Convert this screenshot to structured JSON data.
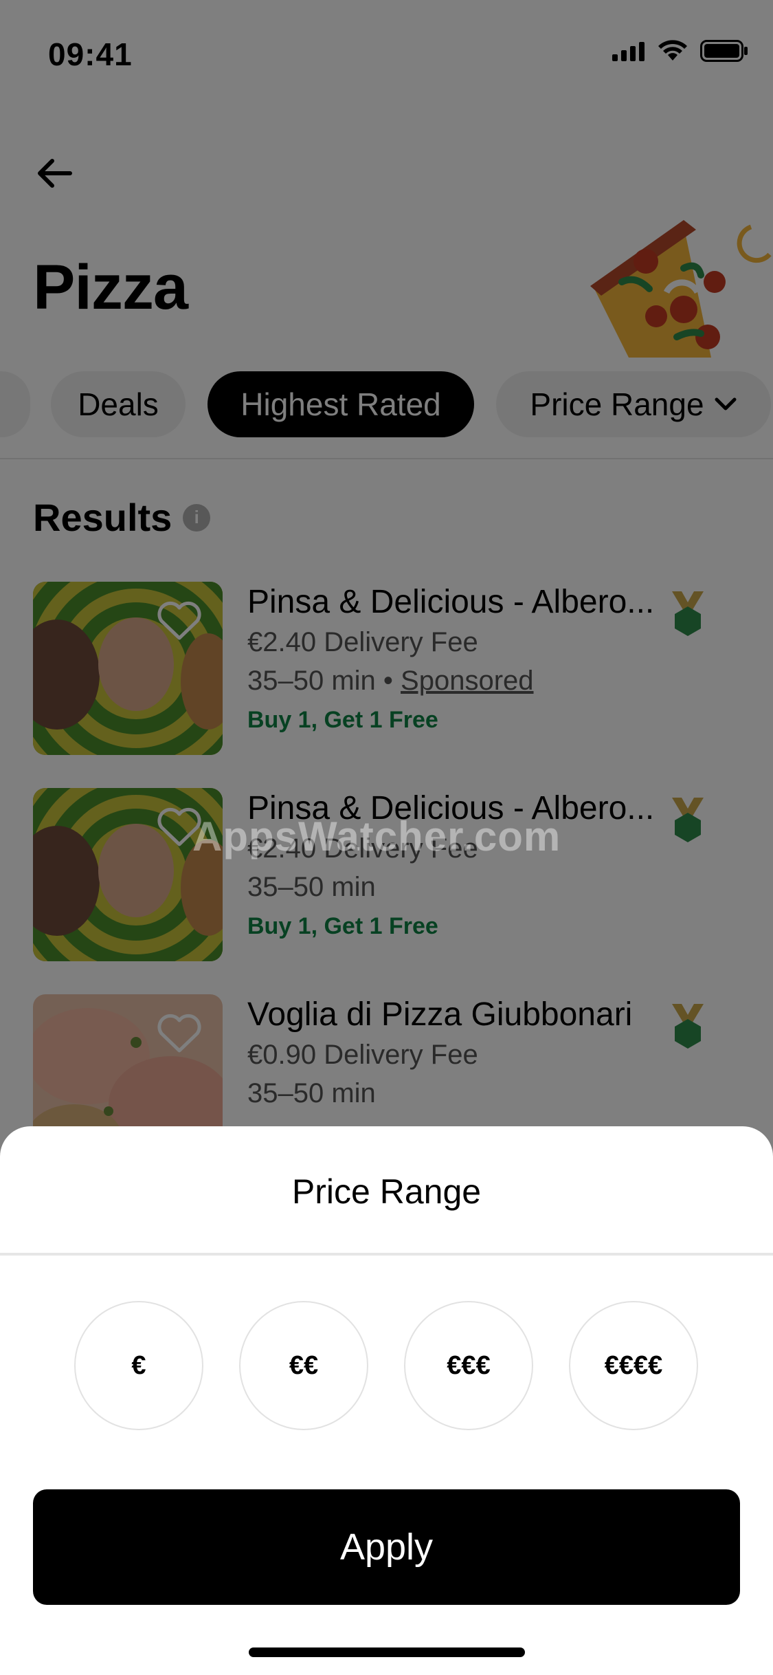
{
  "status_bar": {
    "time": "09:41"
  },
  "header": {
    "title": "Pizza"
  },
  "filters": {
    "chips": [
      {
        "label": "Deals"
      },
      {
        "label": "Highest Rated"
      },
      {
        "label": "Price Range"
      }
    ]
  },
  "results": {
    "title": "Results",
    "items": [
      {
        "name": "Pinsa & Delicious - Albero...",
        "fee": "€2.40 Delivery Fee",
        "time": "35–50 min",
        "separator": " • ",
        "sponsored": "Sponsored",
        "promo": "Buy 1, Get 1 Free"
      },
      {
        "name": "Pinsa & Delicious - Albero...",
        "fee": "€2.40 Delivery Fee",
        "time": "35–50 min",
        "promo": "Buy 1, Get 1 Free"
      },
      {
        "name": "Voglia di Pizza Giubbonari",
        "fee": "€0.90 Delivery Fee",
        "time": "35–50 min"
      }
    ]
  },
  "watermark": "AppsWatcher.com",
  "sheet": {
    "title": "Price Range",
    "options": [
      "€",
      "€€",
      "€€€",
      "€€€€"
    ],
    "apply_label": "Apply"
  },
  "colors": {
    "promo_green": "#0e8345",
    "overlay": "rgba(0,0,0,0.5)",
    "chip_active": "#000000",
    "apply_button": "#000000"
  },
  "icons": [
    "back-arrow-icon",
    "signal-icon",
    "wifi-icon",
    "battery-icon",
    "info-icon",
    "heart-icon",
    "medal-icon",
    "chevron-down-icon"
  ]
}
